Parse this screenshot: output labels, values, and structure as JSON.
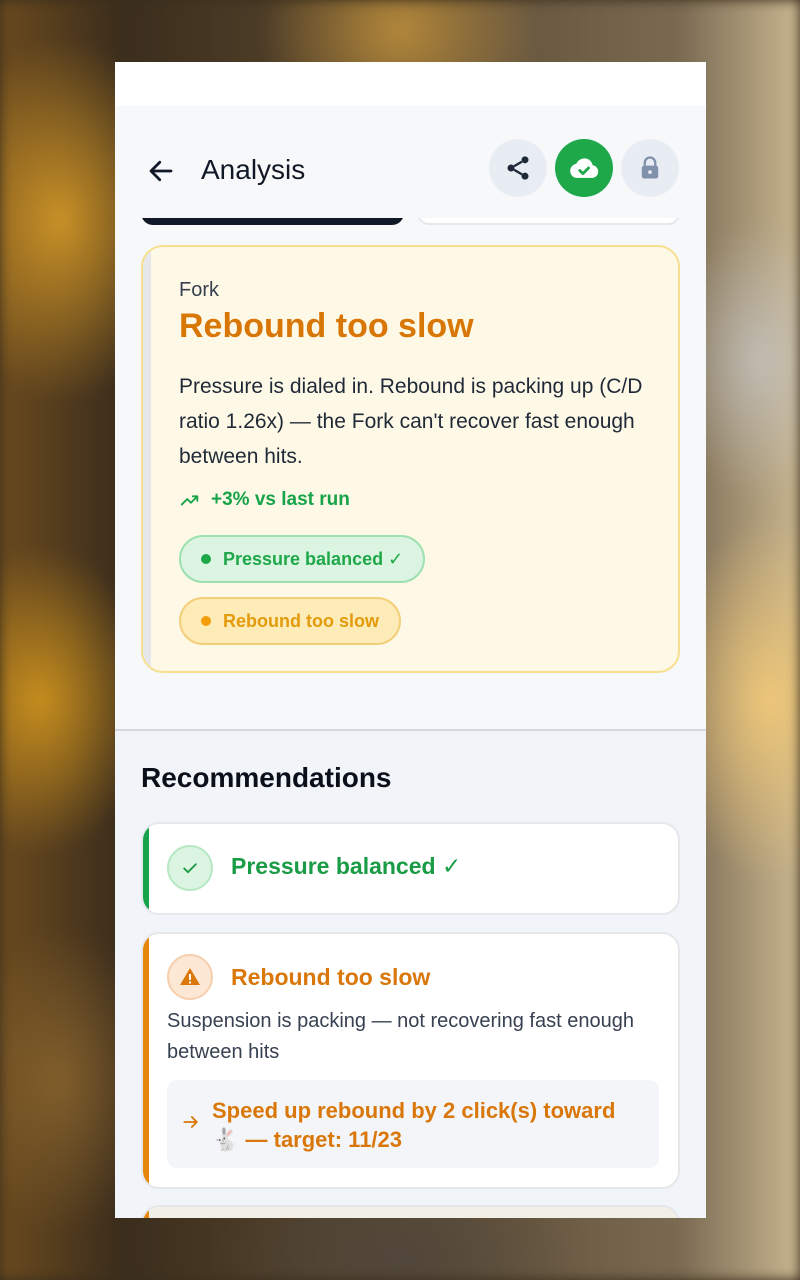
{
  "header": {
    "title": "Analysis",
    "actions": [
      {
        "name": "share",
        "icon": "share-icon"
      },
      {
        "name": "cloud-sync",
        "icon": "cloud-check-icon",
        "color": "#1fa84a"
      },
      {
        "name": "lock",
        "icon": "lock-icon"
      }
    ]
  },
  "diagnosis": {
    "component": "Fork",
    "title": "Rebound too slow",
    "description": "Pressure is dialed in. Rebound is packing up (C/D ratio 1.26x) — the Fork can't recover fast enough between hits.",
    "trend": "+3% vs last run",
    "badges": [
      {
        "label": "Pressure balanced ✓",
        "status": "ok",
        "color": "#1ea84a"
      },
      {
        "label": "Rebound too slow",
        "status": "warn",
        "color": "#e39a0b"
      }
    ]
  },
  "recommendations": {
    "title": "Recommendations",
    "items": [
      {
        "title": "Pressure balanced ✓",
        "status": "ok",
        "icon": "check-icon"
      },
      {
        "title": "Rebound too slow",
        "status": "warn",
        "icon": "warning-icon",
        "description": "Suspension is packing — not recovering fast enough between hits",
        "action": "Speed up rebound by 2 click(s) toward 🐇 — target: 11/23"
      }
    ]
  },
  "colors": {
    "accent_green": "#16a34a",
    "accent_amber": "#d97706",
    "card_warn_bg": "#fef9e6"
  }
}
